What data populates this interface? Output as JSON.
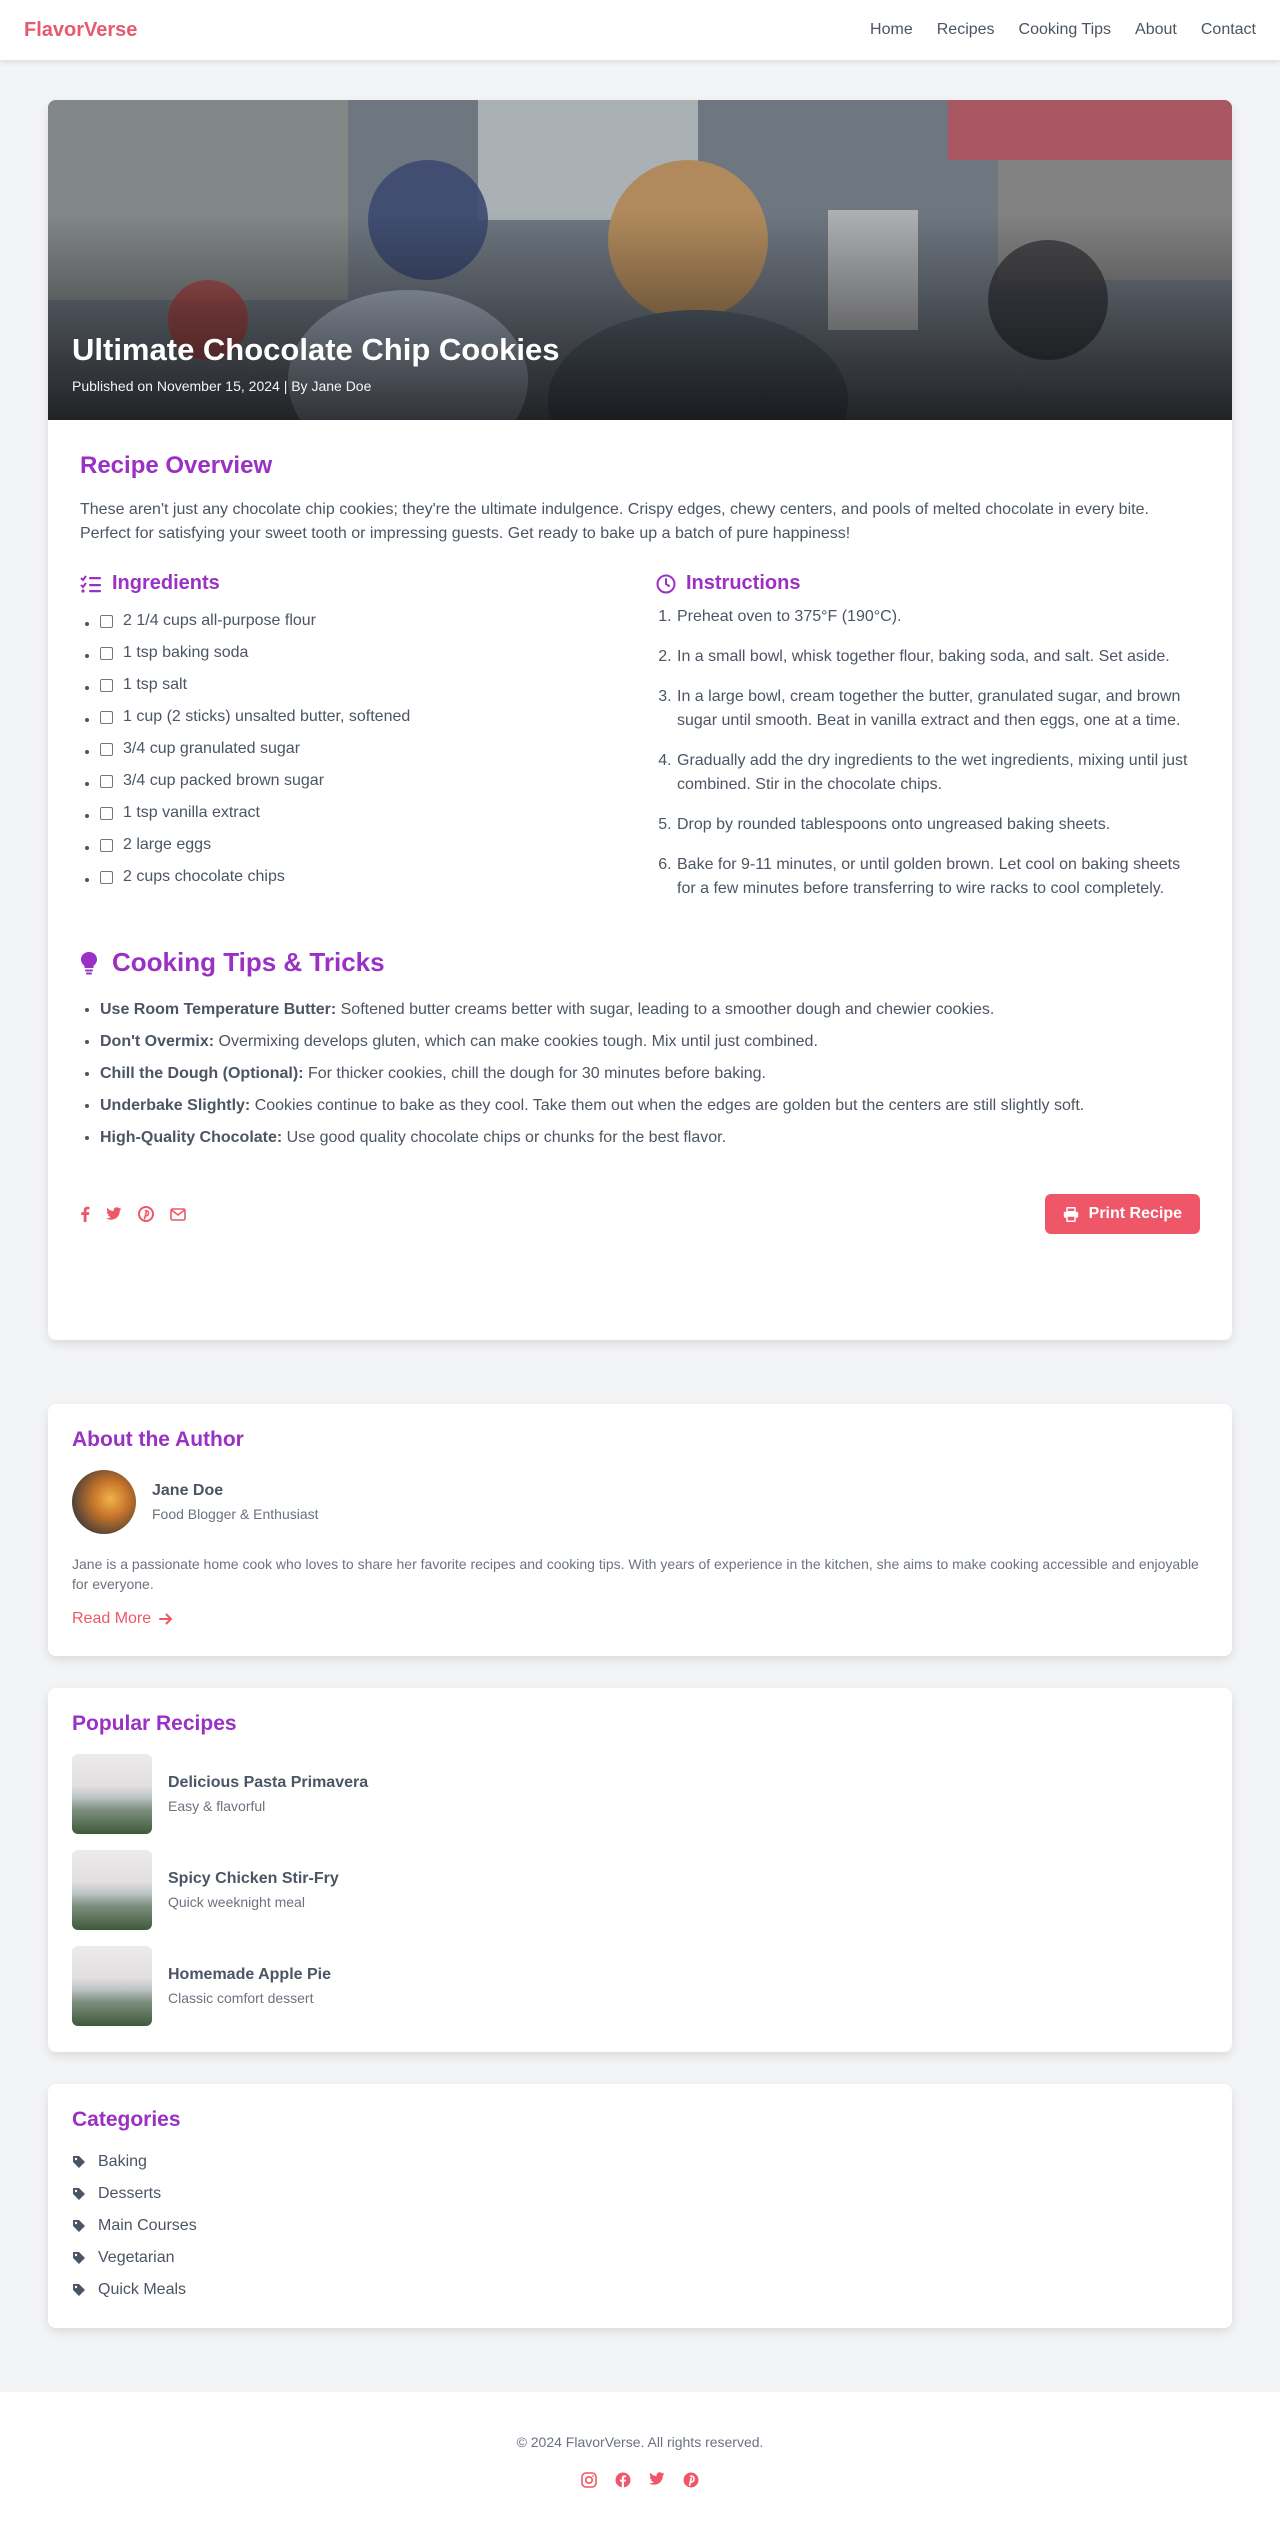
{
  "nav": {
    "brand": "FlavorVerse",
    "links": [
      "Home",
      "Recipes",
      "Cooking Tips",
      "About",
      "Contact"
    ]
  },
  "hero": {
    "title": "Ultimate Chocolate Chip Cookies",
    "meta": "Published on November 15, 2024 | By Jane Doe"
  },
  "overview": {
    "title": "Recipe Overview",
    "text": "These aren't just any chocolate chip cookies; they're the ultimate indulgence. Crispy edges, chewy centers, and pools of melted chocolate in every bite. Perfect for satisfying your sweet tooth or impressing guests. Get ready to bake up a batch of pure happiness!"
  },
  "ingredients": {
    "title": "Ingredients",
    "items": [
      "2 1/4 cups all-purpose flour",
      "1 tsp baking soda",
      "1 tsp salt",
      "1 cup (2 sticks) unsalted butter, softened",
      "3/4 cup granulated sugar",
      "3/4 cup packed brown sugar",
      "1 tsp vanilla extract",
      "2 large eggs",
      "2 cups chocolate chips"
    ]
  },
  "instructions": {
    "title": "Instructions",
    "steps": [
      "Preheat oven to 375°F (190°C).",
      "In a small bowl, whisk together flour, baking soda, and salt. Set aside.",
      "In a large bowl, cream together the butter, granulated sugar, and brown sugar until smooth. Beat in vanilla extract and then eggs, one at a time.",
      "Gradually add the dry ingredients to the wet ingredients, mixing until just combined. Stir in the chocolate chips.",
      "Drop by rounded tablespoons onto ungreased baking sheets.",
      "Bake for 9-11 minutes, or until golden brown. Let cool on baking sheets for a few minutes before transferring to wire racks to cool completely."
    ]
  },
  "tips": {
    "title": "Cooking Tips & Tricks",
    "items": [
      {
        "bold": "Use Room Temperature Butter:",
        "text": " Softened butter creams better with sugar, leading to a smoother dough and chewier cookies."
      },
      {
        "bold": "Don't Overmix:",
        "text": " Overmixing develops gluten, which can make cookies tough. Mix until just combined."
      },
      {
        "bold": "Chill the Dough (Optional):",
        "text": " For thicker cookies, chill the dough for 30 minutes before baking."
      },
      {
        "bold": "Underbake Slightly:",
        "text": " Cookies continue to bake as they cool. Take them out when the edges are golden but the centers are still slightly soft."
      },
      {
        "bold": "High-Quality Chocolate:",
        "text": " Use good quality chocolate chips or chunks for the best flavor."
      }
    ]
  },
  "share": {
    "icons": [
      "facebook-icon",
      "twitter-icon",
      "pinterest-icon",
      "email-icon"
    ],
    "print_label": "Print Recipe"
  },
  "author": {
    "title": "About the Author",
    "name": "Jane Doe",
    "role": "Food Blogger & Enthusiast",
    "bio": "Jane is a passionate home cook who loves to share her favorite recipes and cooking tips. With years of experience in the kitchen, she aims to make cooking accessible and enjoyable for everyone.",
    "read_more": "Read More"
  },
  "popular": {
    "title": "Popular Recipes",
    "items": [
      {
        "title": "Delicious Pasta Primavera",
        "sub": "Easy & flavorful"
      },
      {
        "title": "Spicy Chicken Stir-Fry",
        "sub": "Quick weeknight meal"
      },
      {
        "title": "Homemade Apple Pie",
        "sub": "Classic comfort dessert"
      }
    ]
  },
  "categories": {
    "title": "Categories",
    "items": [
      "Baking",
      "Desserts",
      "Main Courses",
      "Vegetarian",
      "Quick Meals"
    ]
  },
  "footer": {
    "copyright": "© 2024 FlavorVerse. All rights reserved.",
    "icons": [
      "instagram-icon",
      "facebook-icon",
      "twitter-icon",
      "pinterest-icon"
    ]
  },
  "colors": {
    "accent": "#9b30c5",
    "brand": "#e65a6e",
    "button": "#ef5768"
  }
}
